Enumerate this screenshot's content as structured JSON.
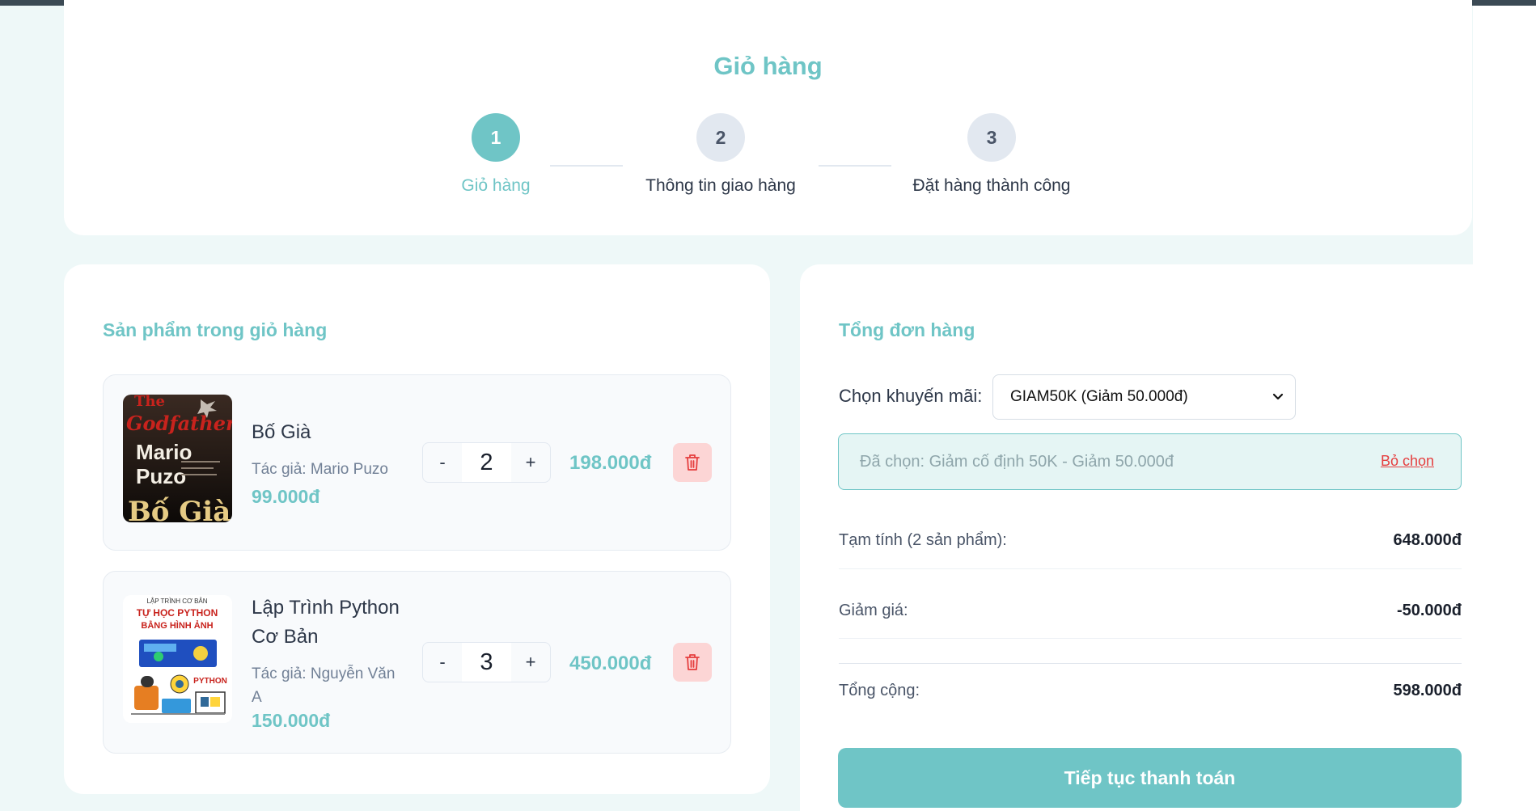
{
  "page": {
    "title": "Giỏ hàng"
  },
  "steps": [
    {
      "number": "1",
      "label": "Giỏ hàng",
      "active": true
    },
    {
      "number": "2",
      "label": "Thông tin giao hàng",
      "active": false
    },
    {
      "number": "3",
      "label": "Đặt hàng thành công",
      "active": false
    }
  ],
  "cart": {
    "title": "Sản phẩm trong giỏ hàng",
    "items": [
      {
        "name": "Bố Già",
        "author": "Tác giả: Mario Puzo",
        "price": "99.000đ",
        "quantity": "2",
        "total": "198.000đ",
        "cover_text": [
          "The",
          "Godfather",
          "Mario",
          "Puzo",
          "Bố Già"
        ]
      },
      {
        "name": "Lập Trình Python Cơ Bản",
        "author": "Tác giả: Nguyễn Văn A",
        "price": "150.000đ",
        "quantity": "3",
        "total": "450.000đ",
        "cover_text": [
          "LẬP TRÌNH CƠ BẢN",
          "TỰ HỌC PYTHON",
          "BẰNG HÌNH ẢNH",
          "PYTHON"
        ]
      }
    ],
    "minus_label": "-",
    "plus_label": "+"
  },
  "summary": {
    "title": "Tổng đơn hàng",
    "promo_label": "Chọn khuyến mãi:",
    "promo_selected": "GIAM50K (Giảm 50.000đ)",
    "selected_text": "Đã chọn: Giảm cố định 50K - Giảm 50.000đ",
    "remove_label": "Bỏ chọn",
    "subtotal_label": "Tạm tính (2 sản phẩm):",
    "subtotal_value": "648.000đ",
    "discount_label": "Giảm giá:",
    "discount_value": "-50.000đ",
    "total_label": "Tổng cộng:",
    "total_value": "598.000đ",
    "checkout_label": "Tiếp tục thanh toán"
  },
  "colors": {
    "accent": "#6fc5c6",
    "background": "#eef8f8",
    "danger": "#e53e3e",
    "danger_bg": "#fcd5d5"
  },
  "icons": [
    "trash-icon",
    "chevron-down-icon"
  ]
}
